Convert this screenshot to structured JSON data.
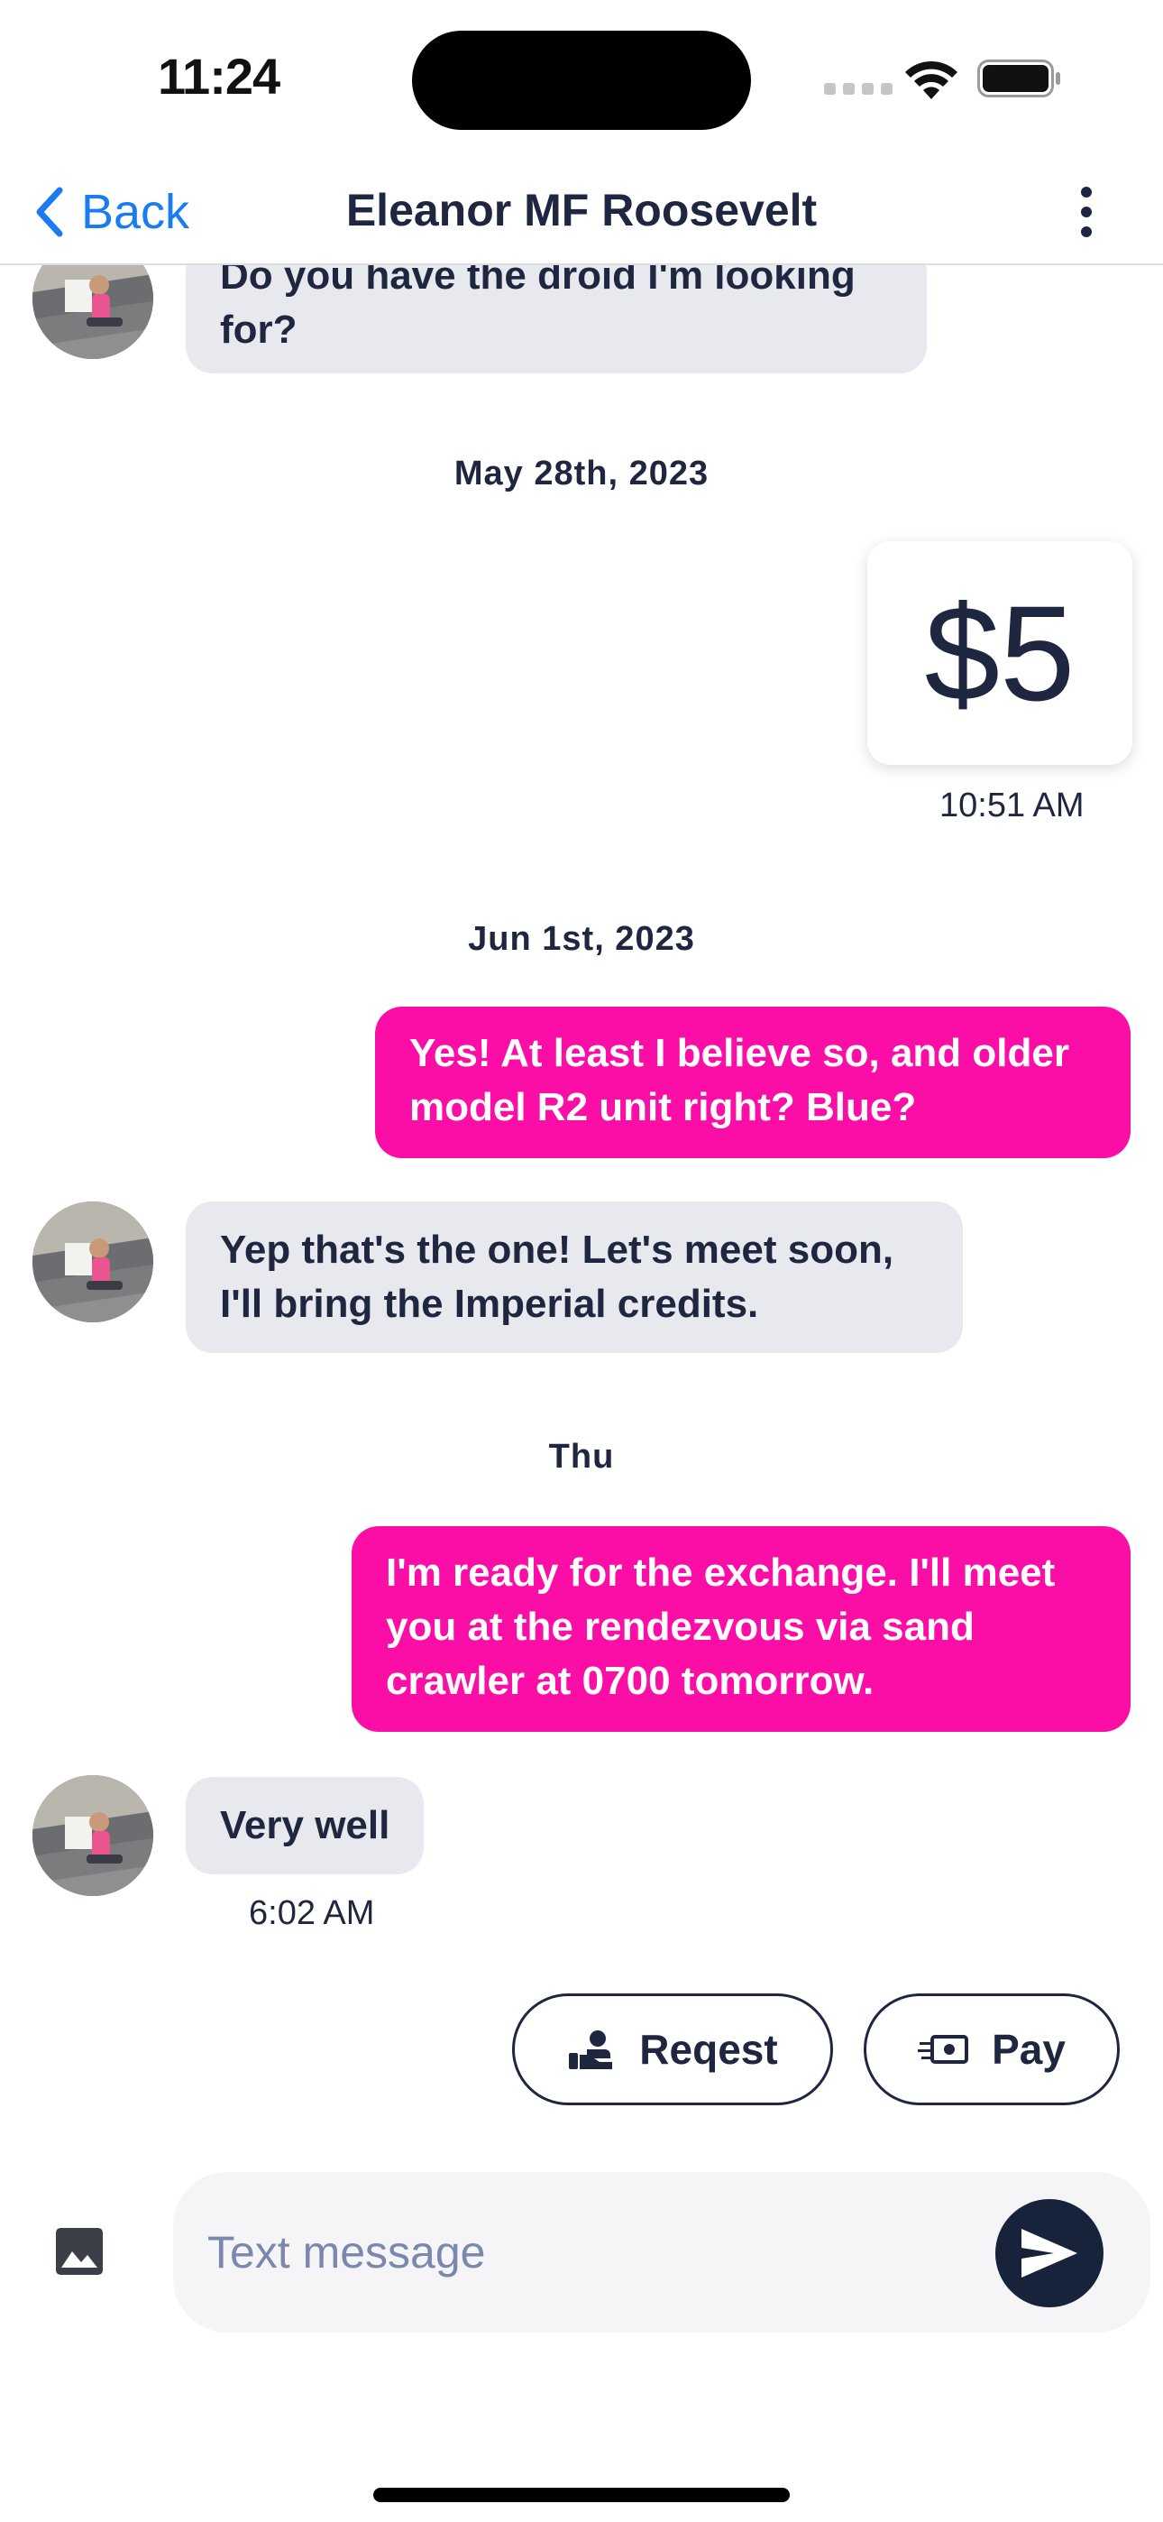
{
  "status_bar": {
    "time": "11:24"
  },
  "nav": {
    "back_label": "Back",
    "title": "Eleanor MF Roosevelt"
  },
  "messages": [
    {
      "type": "incoming",
      "text": "Do you have the droid I'm looking for?"
    },
    {
      "type": "date",
      "text": "May 28th, 2023"
    },
    {
      "type": "payment",
      "amount": "$5",
      "time": "10:51 AM"
    },
    {
      "type": "date",
      "text": "Jun 1st, 2023"
    },
    {
      "type": "outgoing",
      "text": "Yes! At least I believe so, and older model R2 unit right? Blue?"
    },
    {
      "type": "incoming",
      "text": "Yep that's the one! Let's meet soon, I'll bring the Imperial credits."
    },
    {
      "type": "date",
      "text": "Thu"
    },
    {
      "type": "outgoing",
      "text": "I'm ready for the exchange. I'll meet you at the rendezvous via sand crawler at 0700 tomorrow."
    },
    {
      "type": "incoming",
      "text": "Very well",
      "time": "6:02 AM"
    }
  ],
  "actions": {
    "request_label": "Reqest",
    "pay_label": "Pay"
  },
  "composer": {
    "placeholder": "Text message",
    "value": ""
  },
  "colors": {
    "accent_pink": "#fb0ea6",
    "navy": "#1e2640",
    "back_blue": "#1a7cf0",
    "incoming_bg": "#e8e9ee"
  },
  "icons": [
    "back-chevron-icon",
    "more-vertical-icon",
    "request-money-icon",
    "pay-cash-icon",
    "image-icon",
    "send-icon",
    "wifi-icon",
    "battery-icon",
    "cellular-signal-icon"
  ]
}
